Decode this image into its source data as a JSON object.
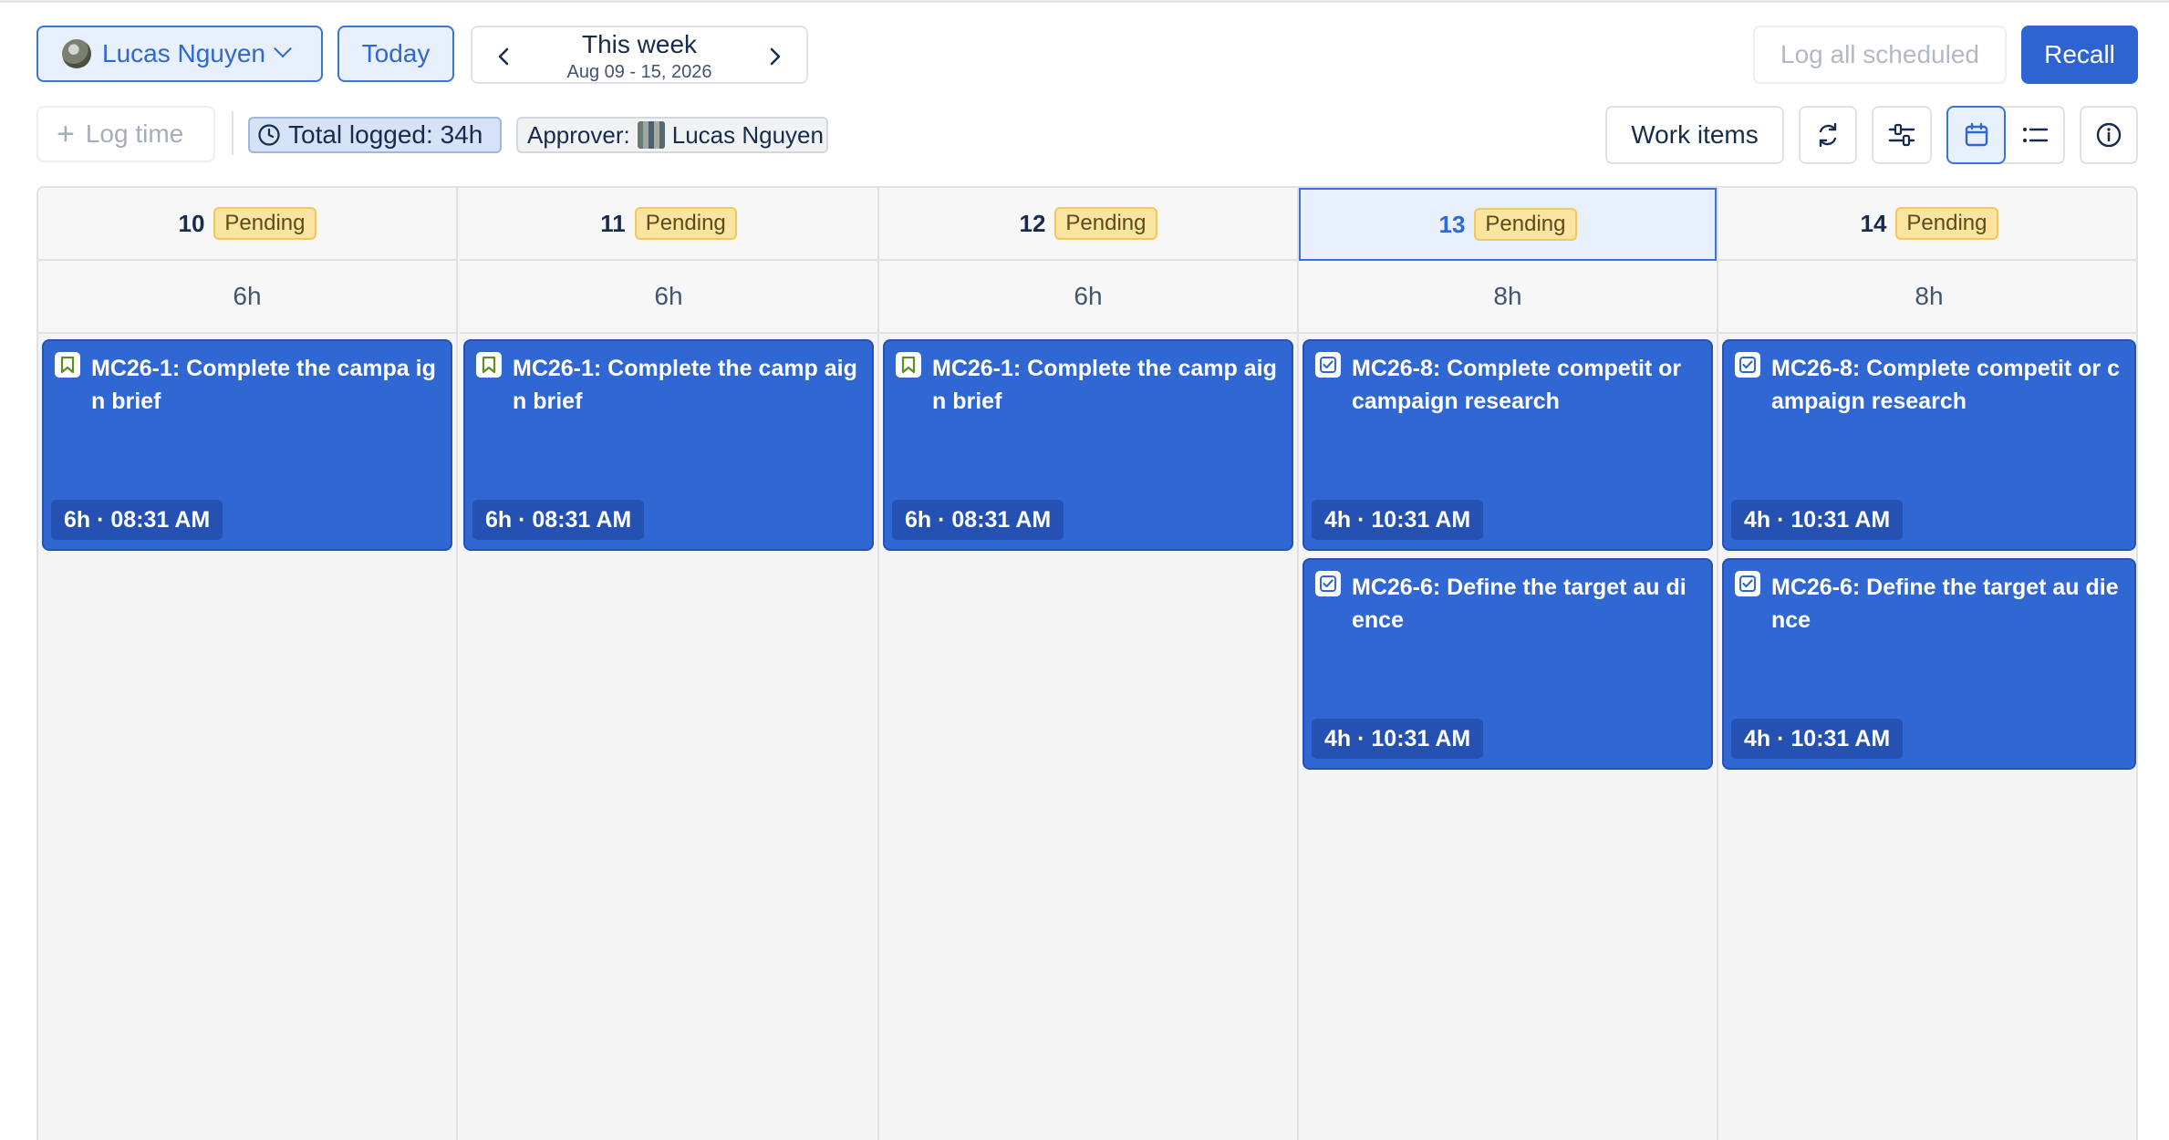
{
  "toolbar": {
    "user_name": "Lucas Nguyen",
    "today_label": "Today",
    "week_title": "This week",
    "week_range": "Aug 09 - 15, 2026",
    "log_all_label": "Log all scheduled",
    "recall_label": "Recall",
    "log_time_label": "Log time",
    "total_logged": "Total logged: 34h",
    "approver_label": "Approver:",
    "approver_name": "Lucas Nguyen",
    "work_items_label": "Work items"
  },
  "columns": [
    {
      "day": "10",
      "status": "Pending",
      "total": "6h",
      "is_today": false,
      "entries": [
        {
          "icon": "bookmark-icon",
          "title": "MC26-1: Complete the campa ign brief",
          "meta": "6h · 08:31 AM"
        }
      ]
    },
    {
      "day": "11",
      "status": "Pending",
      "total": "6h",
      "is_today": false,
      "entries": [
        {
          "icon": "bookmark-icon",
          "title": "MC26-1: Complete the camp aign brief",
          "meta": "6h · 08:31 AM"
        }
      ]
    },
    {
      "day": "12",
      "status": "Pending",
      "total": "6h",
      "is_today": false,
      "entries": [
        {
          "icon": "bookmark-icon",
          "title": "MC26-1: Complete the camp aign brief",
          "meta": "6h · 08:31 AM"
        }
      ]
    },
    {
      "day": "13",
      "status": "Pending",
      "total": "8h",
      "is_today": true,
      "entries": [
        {
          "icon": "checkbox-icon",
          "title": "MC26-8: Complete competit or campaign research",
          "meta": "4h · 10:31 AM"
        },
        {
          "icon": "checkbox-icon",
          "title": "MC26-6: Define the target au dience",
          "meta": "4h · 10:31 AM"
        }
      ]
    },
    {
      "day": "14",
      "status": "Pending",
      "total": "8h",
      "is_today": false,
      "entries": [
        {
          "icon": "checkbox-icon",
          "title": "MC26-8: Complete competit or campaign research",
          "meta": "4h · 10:31 AM"
        },
        {
          "icon": "checkbox-icon",
          "title": "MC26-6: Define the target au dience",
          "meta": "4h · 10:31 AM"
        }
      ]
    }
  ],
  "colors": {
    "accent": "#2e63d2",
    "entry_bg": "#3067d3",
    "pending_bg": "#fbe3a0",
    "calendar_bg": "#f4f4f4"
  }
}
